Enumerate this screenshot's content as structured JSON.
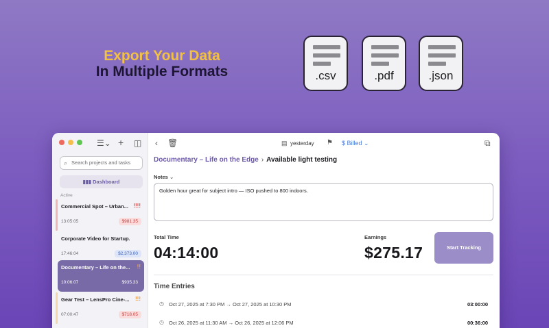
{
  "hero": {
    "line1": "Export Your Data",
    "line2": "In Multiple Formats"
  },
  "formats": [
    ".csv",
    ".pdf",
    ".json"
  ],
  "sidebar": {
    "search_placeholder": "Search projects and tasks",
    "dashboard_label": "Dashboard",
    "section_label": "Active",
    "projects": [
      {
        "name": "Commercial Spot – Urban...",
        "priority": "!!!!",
        "time": "13:05:05",
        "amount": "$981.35"
      },
      {
        "name": "Corporate Video for Startup...",
        "priority": "",
        "time": "17:46:04",
        "amount": "$2,373.00"
      },
      {
        "name": "Documentary – Life on the...",
        "priority": "!!",
        "time": "10:06:07",
        "amount": "$935.33"
      },
      {
        "name": "Gear Test – LensPro Cine-...",
        "priority": "!!!",
        "time": "07:00:47",
        "amount": "$718.05"
      }
    ]
  },
  "toolbar": {
    "date_label": "yesterday",
    "billed_label": "Billed"
  },
  "main": {
    "project": "Documentary – Life on the Edge",
    "task": "Available light testing",
    "notes_label": "Notes",
    "notes": "Golden hour great for subject intro — ISO pushed to 800 indoors.",
    "total_label": "Total Time",
    "total_value": "04:14:00",
    "earnings_label": "Earnings",
    "earnings_value": "$275.17",
    "start_label": "Start Tracking",
    "entries_title": "Time Entries",
    "entries": [
      {
        "start": "Oct 27, 2025 at 7:30 PM",
        "end": "Oct 27, 2025 at 10:30 PM",
        "duration": "03:00:00"
      },
      {
        "start": "Oct 26, 2025 at 11:30 AM",
        "end": "Oct 26, 2025 at 12:06 PM",
        "duration": "00:36:00"
      }
    ]
  },
  "colors": {
    "accent": "#6d5aaa",
    "highlight": "#f3c142",
    "selected": "#786aa6"
  }
}
